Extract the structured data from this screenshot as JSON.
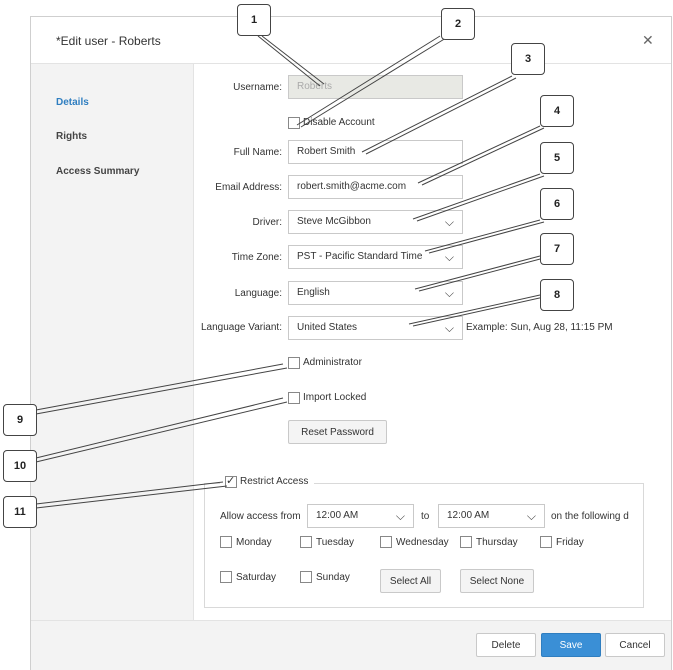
{
  "dialog": {
    "title": "*Edit user - Roberts",
    "close_icon": "close-icon"
  },
  "sidebar": {
    "items": [
      {
        "label": "Details",
        "active": true
      },
      {
        "label": "Rights",
        "active": false
      },
      {
        "label": "Access Summary",
        "active": false
      }
    ]
  },
  "form": {
    "username_label": "Username:",
    "username_value": "Roberts",
    "disable_account_label": "Disable Account",
    "disable_account_checked": false,
    "fullname_label": "Full Name:",
    "fullname_value": "Robert Smith",
    "email_label": "Email Address:",
    "email_value": "robert.smith@acme.com",
    "driver_label": "Driver:",
    "driver_value": "Steve McGibbon",
    "timezone_label": "Time Zone:",
    "timezone_value": "PST - Pacific Standard Time",
    "language_label": "Language:",
    "language_value": "English",
    "variant_label": "Language Variant:",
    "variant_value": "United States",
    "variant_example": "Example: Sun, Aug 28, 11:15 PM",
    "administrator_label": "Administrator",
    "administrator_checked": false,
    "import_locked_label": "Import Locked",
    "import_locked_checked": false,
    "reset_password": "Reset Password"
  },
  "restrict": {
    "label": "Restrict Access",
    "checked": true,
    "allow_from": "Allow access from",
    "from_value": "12:00 AM",
    "to": "to",
    "to_value": "12:00 AM",
    "following": "on the following d",
    "days": [
      "Monday",
      "Tuesday",
      "Wednesday",
      "Thursday",
      "Friday",
      "Saturday",
      "Sunday"
    ],
    "select_all": "Select All",
    "select_none": "Select None"
  },
  "footer": {
    "delete": "Delete",
    "save": "Save",
    "cancel": "Cancel"
  },
  "callouts": [
    "1",
    "2",
    "3",
    "4",
    "5",
    "6",
    "7",
    "8",
    "9",
    "10",
    "11"
  ],
  "colors": {
    "accent": "#3a8fd6",
    "active_nav": "#2f7ec0",
    "sidebar_bg": "#f3f3f3"
  }
}
